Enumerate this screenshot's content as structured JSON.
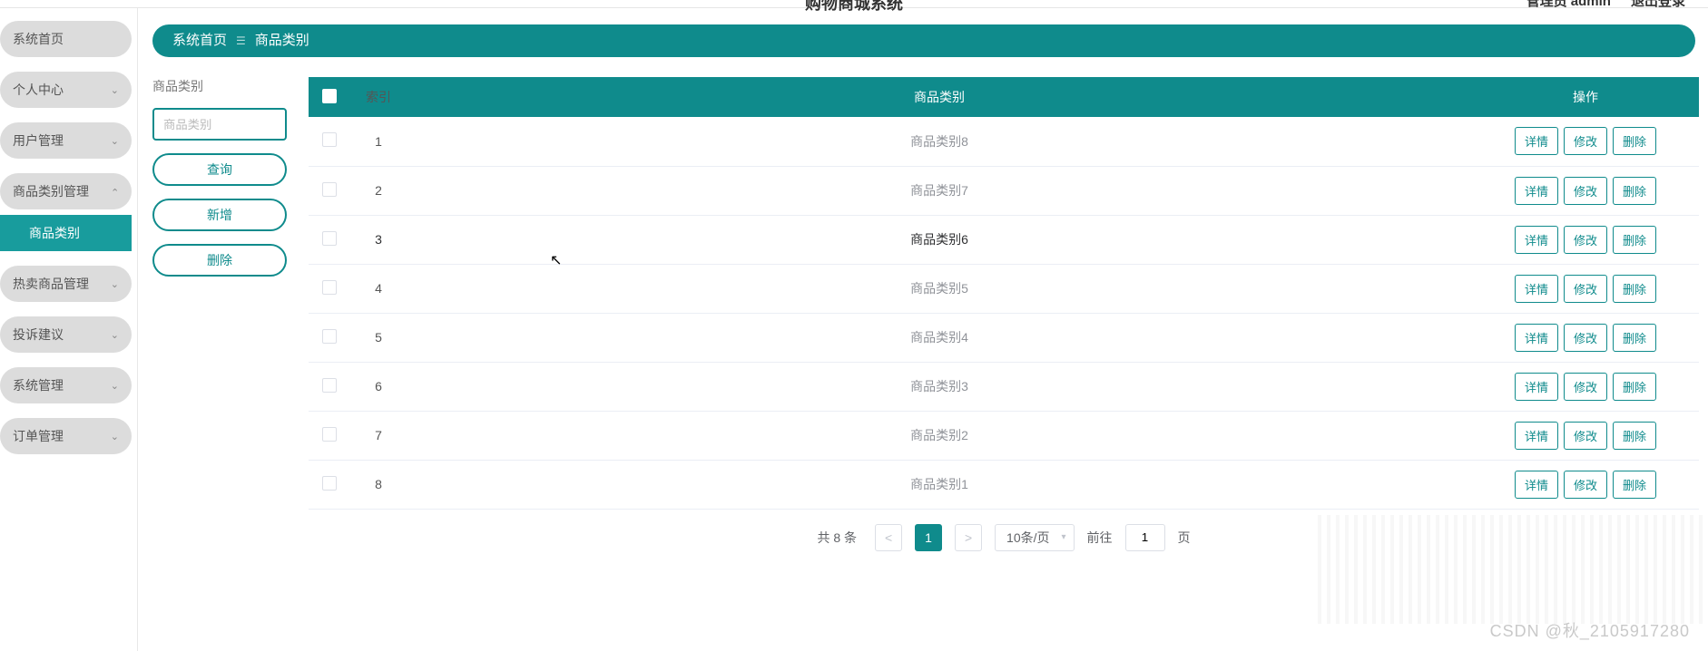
{
  "header": {
    "app_title": "购物商城系统",
    "user_prefix": "管理员",
    "user_name": "admin",
    "logout": "退出登录"
  },
  "sidebar": {
    "items": [
      {
        "label": "系统首页",
        "has_children": false
      },
      {
        "label": "个人中心",
        "has_children": true,
        "expanded": false
      },
      {
        "label": "用户管理",
        "has_children": true,
        "expanded": false
      },
      {
        "label": "商品类别管理",
        "has_children": true,
        "expanded": true,
        "children": [
          {
            "label": "商品类别",
            "active": true
          }
        ]
      },
      {
        "label": "热卖商品管理",
        "has_children": true,
        "expanded": false
      },
      {
        "label": "投诉建议",
        "has_children": true,
        "expanded": false
      },
      {
        "label": "系统管理",
        "has_children": true,
        "expanded": false
      },
      {
        "label": "订单管理",
        "has_children": true,
        "expanded": false
      }
    ]
  },
  "breadcrumb": {
    "home": "系统首页",
    "sep": "☰",
    "current": "商品类别"
  },
  "filter": {
    "label": "商品类别",
    "placeholder": "商品类别",
    "buttons": {
      "search": "查询",
      "add": "新增",
      "delete": "删除"
    }
  },
  "table": {
    "columns": {
      "index": "索引",
      "name": "商品类别",
      "ops": "操作"
    },
    "rows": [
      {
        "index": 1,
        "name": "商品类别8"
      },
      {
        "index": 2,
        "name": "商品类别7"
      },
      {
        "index": 3,
        "name": "商品类别6",
        "hover": true
      },
      {
        "index": 4,
        "name": "商品类别5"
      },
      {
        "index": 5,
        "name": "商品类别4"
      },
      {
        "index": 6,
        "name": "商品类别3"
      },
      {
        "index": 7,
        "name": "商品类别2"
      },
      {
        "index": 8,
        "name": "商品类别1"
      }
    ],
    "op_labels": {
      "detail": "详情",
      "edit": "修改",
      "delete": "删除"
    }
  },
  "pagination": {
    "total_text": "共 8 条",
    "prev": "<",
    "next": ">",
    "current_page": "1",
    "page_size_label": "10条/页",
    "jump_prefix": "前往",
    "jump_value": "1",
    "jump_suffix": "页"
  },
  "watermark": "CSDN @秋_2105917280",
  "colors": {
    "primary": "#0f8b8c"
  }
}
